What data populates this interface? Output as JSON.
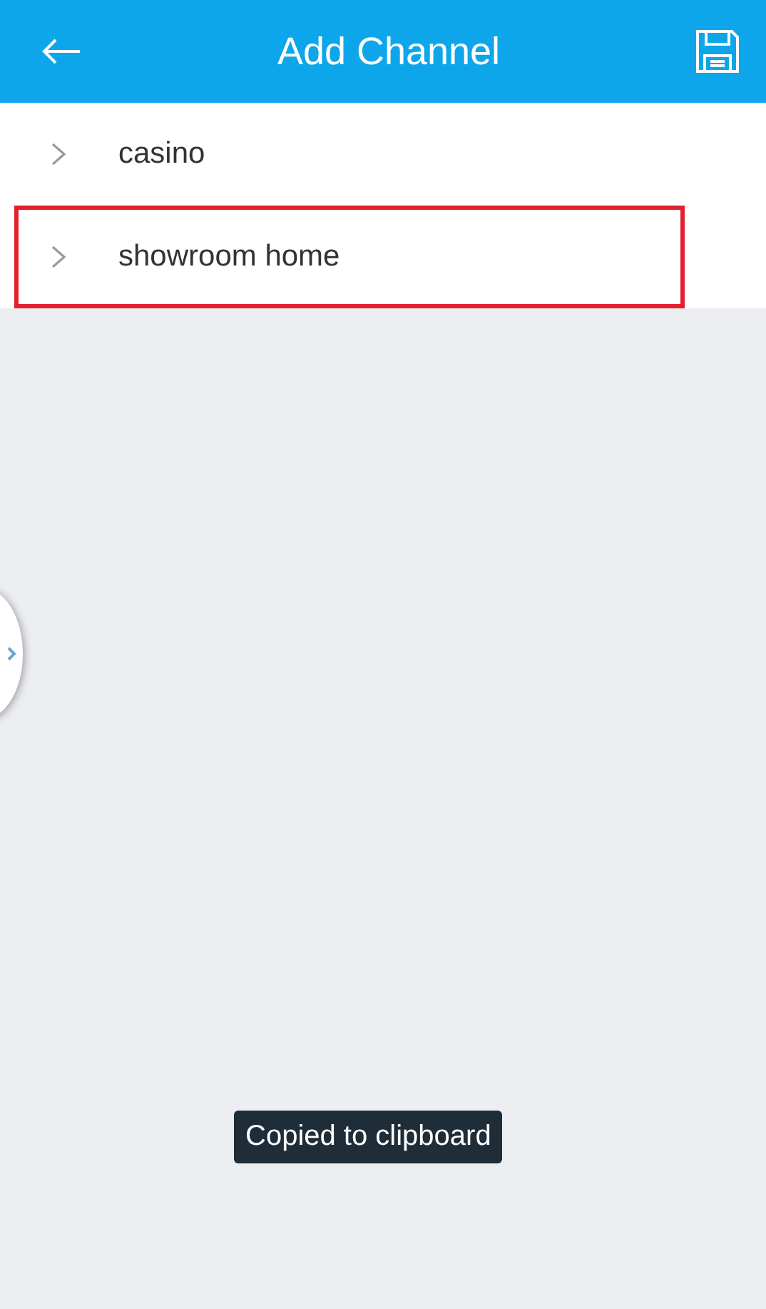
{
  "header": {
    "title": "Add Channel"
  },
  "items": [
    {
      "label": "casino",
      "highlighted": false
    },
    {
      "label": "showroom home",
      "highlighted": true
    }
  ],
  "toast": "Copied to clipboard"
}
